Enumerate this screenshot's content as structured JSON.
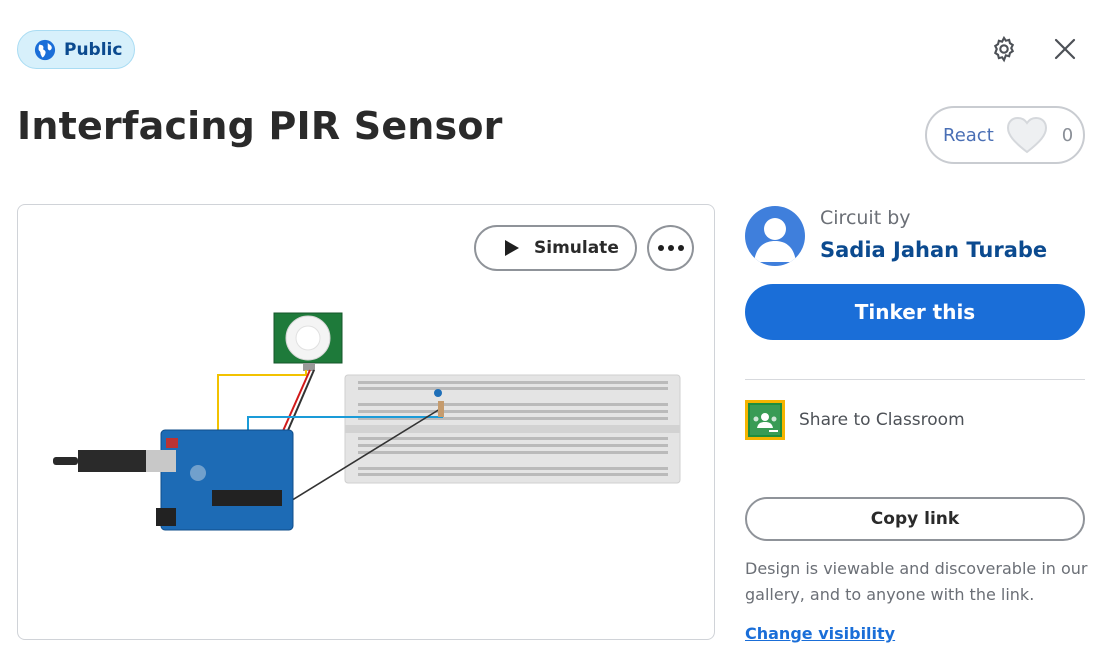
{
  "badge": {
    "label": "Public",
    "icon": "globe-icon"
  },
  "header": {
    "settings_icon": "gear-icon",
    "close_icon": "close-icon"
  },
  "title": "Interfacing PIR Sensor",
  "react": {
    "label": "React",
    "count": "0",
    "icon": "heart-icon"
  },
  "preview": {
    "simulate_label": "Simulate",
    "more_icon": "more-horizontal-icon"
  },
  "author": {
    "prefix": "Circuit by",
    "name": "Sadia Jahan Turabe"
  },
  "actions": {
    "tinker_label": "Tinker this",
    "classroom_label": "Share to Classroom",
    "copy_link_label": "Copy link",
    "visibility_description": "Design is viewable and discoverable in our gallery, and to anyone with the link.",
    "change_visibility_label": "Change visibility"
  },
  "colors": {
    "accent": "#1a6ed8",
    "link": "#0b4a8f",
    "badge_bg": "#d7f0fb"
  }
}
